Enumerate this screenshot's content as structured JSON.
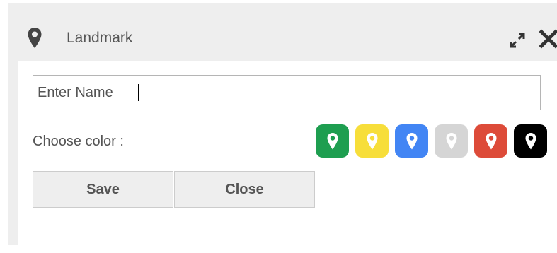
{
  "dialog": {
    "title": "Landmark",
    "title_icon": "map-pin-icon",
    "expand_icon": "expand-icon",
    "close_icon": "close-icon"
  },
  "form": {
    "name_placeholder": "Enter Name",
    "name_value": "",
    "choose_color_label": "Choose color :",
    "colors": [
      {
        "name": "green",
        "hex": "#1e9e50"
      },
      {
        "name": "yellow",
        "hex": "#f7de3a"
      },
      {
        "name": "blue",
        "hex": "#4285f4"
      },
      {
        "name": "grey",
        "hex": "#d5d5d5"
      },
      {
        "name": "red",
        "hex": "#dd4b39"
      },
      {
        "name": "black",
        "hex": "#000000"
      }
    ],
    "save_label": "Save",
    "close_label": "Close"
  }
}
